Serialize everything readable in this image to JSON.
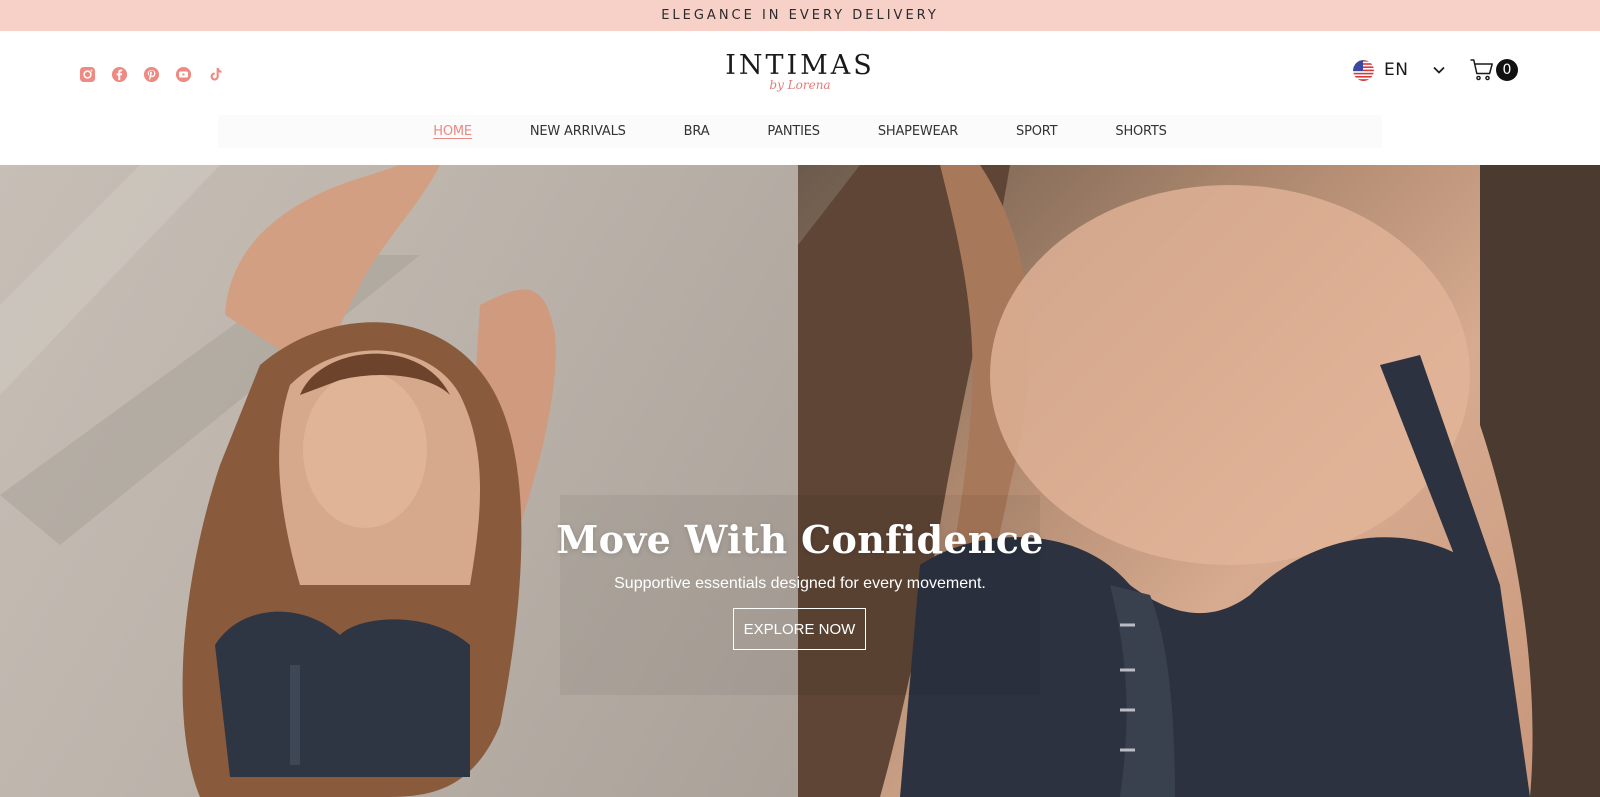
{
  "announcement": "ELEGANCE IN EVERY DELIVERY",
  "header": {
    "logo_main": "INTIMAS",
    "logo_sub": "by Lorena",
    "language": "EN",
    "cart_count": "0",
    "socials": [
      "instagram-icon",
      "facebook-icon",
      "pinterest-icon",
      "youtube-icon",
      "tiktok-icon"
    ]
  },
  "nav": {
    "items": [
      {
        "label": "HOME",
        "active": true
      },
      {
        "label": "NEW ARRIVALS"
      },
      {
        "label": "BRA"
      },
      {
        "label": "PANTIES"
      },
      {
        "label": "SHAPEWEAR"
      },
      {
        "label": "SPORT"
      },
      {
        "label": "SHORTS"
      }
    ]
  },
  "hero": {
    "title": "Move With Confidence",
    "subtitle": "Supportive essentials designed for every movement.",
    "cta": "EXPLORE NOW"
  },
  "colors": {
    "announcement_bg": "#f7d1c8",
    "accent": "#e98a84",
    "social_icon": "#ef8a82"
  }
}
